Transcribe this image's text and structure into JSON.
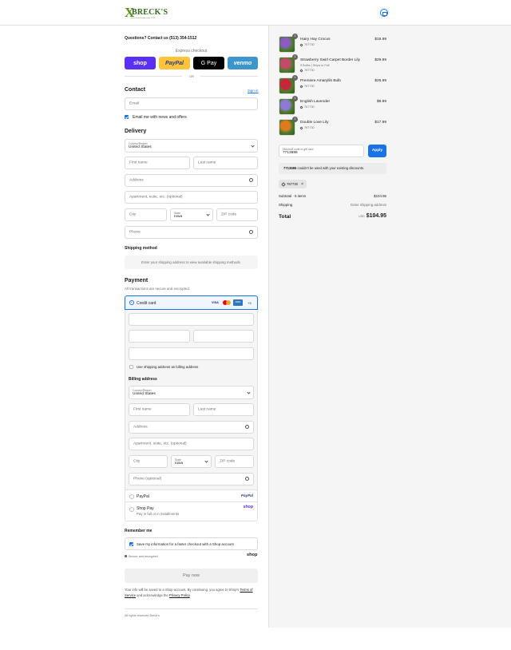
{
  "brand": {
    "name": "BRECK'S",
    "tagline": "Direct from Europe Since 1818"
  },
  "contact_line": "Questions? Contact us (513) 354-1512",
  "express": {
    "label": "Express checkout",
    "buttons": [
      "shop",
      "PayPal",
      "G Pay",
      "venmo"
    ],
    "or": "OR"
  },
  "contact": {
    "heading": "Contact",
    "sign_in": "Sign in",
    "email_placeholder": "Email",
    "news_label": "Email me with news and offers"
  },
  "delivery": {
    "heading": "Delivery",
    "country_label": "Country/Region",
    "country_value": "United States",
    "first_name": "First name",
    "last_name": "Last name",
    "address": "Address",
    "apartment": "Apartment, suite, etc. (optional)",
    "city": "City",
    "state_label": "State",
    "state_value": "Iowa",
    "zip": "ZIP code",
    "phone": "Phone"
  },
  "shipping_method": {
    "heading": "Shipping method",
    "note": "Enter your shipping address to view available shipping methods."
  },
  "payment": {
    "heading": "Payment",
    "sub": "All transactions are secure and encrypted.",
    "credit_card": "Credit card",
    "card_brands": [
      "VISA",
      "MC",
      "AMEX"
    ],
    "more": "+3",
    "use_shipping": "Use shipping address as billing address",
    "billing_heading": "Billing address",
    "billing_phone": "Phone (optional)",
    "paypal": "PayPal",
    "shop_pay": "Shop Pay",
    "shop_pay_sub": "Pay in full or in installments"
  },
  "remember": {
    "heading": "Remember me",
    "save_label": "Save my information for a faster checkout with a Shop account",
    "secure": "Secure and encrypted",
    "shop": "shop"
  },
  "pay_now": "Pay now",
  "legal": {
    "pre": "Your info will be saved to a Shop account. By continuing, you agree to Shop's",
    "terms": "Terms of Service",
    "mid": "and acknowledge the",
    "privacy": "Privacy Policy",
    "end": "."
  },
  "footer": "All rights reserved Breck's",
  "cart": {
    "items": [
      {
        "name": "Hairy Hay Crocus",
        "sub": "",
        "code": "767730",
        "price": "$19.99",
        "qty": "1",
        "color": "#8a5bc0"
      },
      {
        "name": "Strawberry Swirl Carpet Border Lily",
        "sub": "9 Bulbs | Ships in Fall",
        "code": "767730",
        "price": "$29.99",
        "qty": "1",
        "color": "#c44a6a"
      },
      {
        "name": "Premiere Amaryllis Bulb",
        "sub": "",
        "code": "767730",
        "price": "$26.99",
        "qty": "1",
        "color": "#c8243a"
      },
      {
        "name": "English Lavender",
        "sub": "",
        "code": "767730",
        "price": "$9.99",
        "qty": "1",
        "color": "#8e7ad6"
      },
      {
        "name": "Double Love Lily",
        "sub": "",
        "code": "767730",
        "price": "$17.99",
        "qty": "1",
        "color": "#e07a1e"
      }
    ],
    "discount_label": "Discount code or gift card",
    "discount_value": "7713686",
    "apply": "Apply",
    "error_code": "7713686",
    "error_text": "couldn't be used with your existing discounts.",
    "applied_tag": "767730",
    "subtotal_label": "Subtotal · 5 items",
    "subtotal": "$104.95",
    "shipping_label": "Shipping",
    "shipping_value": "Enter shipping address",
    "total_label": "Total",
    "currency": "USD",
    "total": "$104.95"
  }
}
